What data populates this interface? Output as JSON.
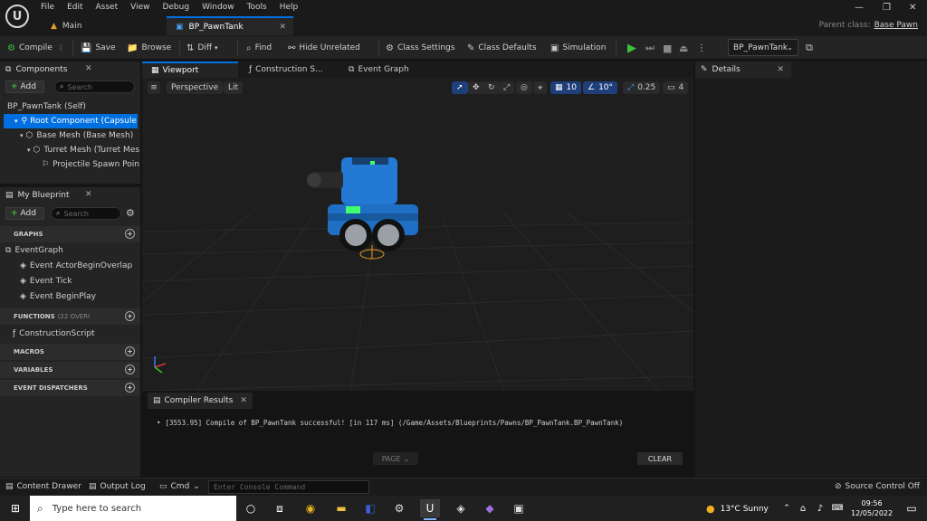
{
  "menu": [
    "File",
    "Edit",
    "Asset",
    "View",
    "Debug",
    "Window",
    "Tools",
    "Help"
  ],
  "doc_tabs": [
    {
      "label": "Main"
    },
    {
      "label": "BP_PawnTank"
    }
  ],
  "parent_class": {
    "label": "Parent class:",
    "value": "Base Pawn"
  },
  "toolbar": {
    "compile": "Compile",
    "save": "Save",
    "browse": "Browse",
    "diff": "Diff",
    "find": "Find",
    "hide_unrelated": "Hide Unrelated",
    "class_settings": "Class Settings",
    "class_defaults": "Class Defaults",
    "simulation": "Simulation",
    "blueprint_select": "BP_PawnTank"
  },
  "components": {
    "title": "Components",
    "add": "Add",
    "search_placeholder": "Search",
    "items": [
      "BP_PawnTank (Self)",
      "Root Component (Capsule",
      "Base Mesh (Base Mesh)",
      "Turret Mesh (Turret Mes",
      "Projectile Spawn Point"
    ]
  },
  "my_blueprint": {
    "title": "My Blueprint",
    "add": "Add",
    "search_placeholder": "Search",
    "graphs_header": "GRAPHS",
    "graphs": [
      "EventGraph",
      "Event ActorBeginOverlap",
      "Event Tick",
      "Event BeginPlay"
    ],
    "functions_header": "FUNCTIONS",
    "functions_sub": "(22 OVERI",
    "functions": [
      "ConstructionScript"
    ],
    "macros_header": "MACROS",
    "variables_header": "VARIABLES",
    "dispatchers_header": "EVENT DISPATCHERS"
  },
  "editor_tabs": [
    "Viewport",
    "Construction S...",
    "Event Graph"
  ],
  "details": {
    "title": "Details"
  },
  "viewport": {
    "perspective": "Perspective",
    "lit": "Lit",
    "grid": "10",
    "angle": "10°",
    "scale": "0.25",
    "camera_speed": "4"
  },
  "compiler": {
    "title": "Compiler Results",
    "message": "[3553.95] Compile of BP_PawnTank successful! [in 117 ms] (/Game/Assets/Blueprints/Pawns/BP_PawnTank.BP_PawnTank)",
    "page": "PAGE",
    "clear": "CLEAR"
  },
  "status": {
    "content_drawer": "Content Drawer",
    "output_log": "Output Log",
    "cmd": "Cmd",
    "console_placeholder": "Enter Console Command",
    "source_control": "Source Control Off"
  },
  "taskbar": {
    "search_placeholder": "Type here to search",
    "weather": "13°C  Sunny",
    "time": "09:56",
    "date": "12/05/2022"
  },
  "colors": {
    "accent": "#0070e0",
    "play_green": "#3cc13c",
    "tank_blue": "#1f6fc4"
  }
}
